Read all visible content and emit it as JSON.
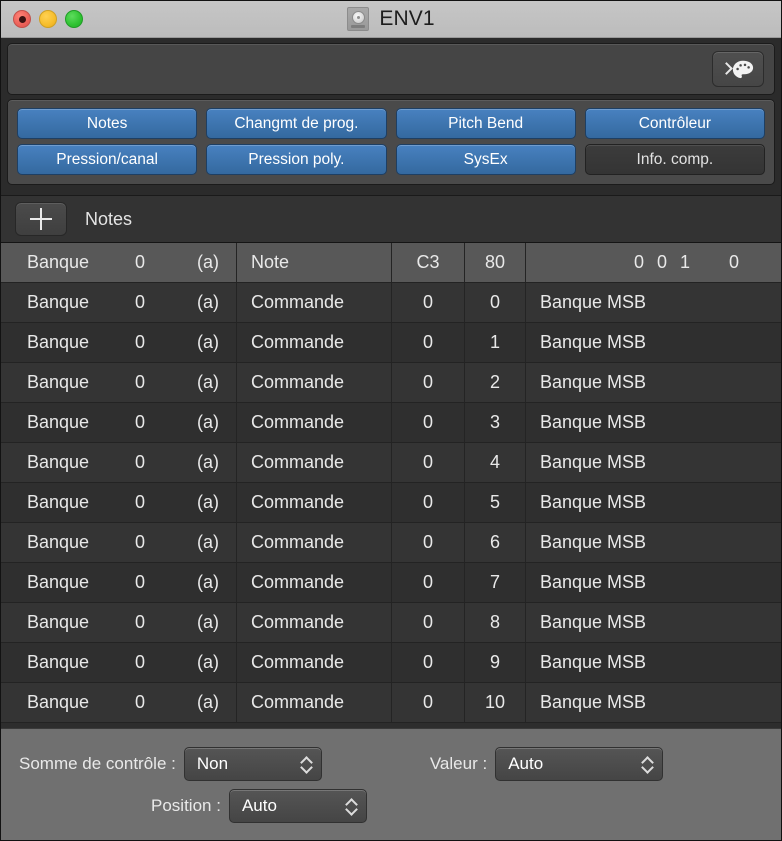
{
  "window": {
    "title": "ENV1",
    "doc_icon": "document-disc-icon",
    "traffic_lights": [
      {
        "name": "close-button",
        "color": "#ec6159"
      },
      {
        "name": "minimize-button",
        "color": "#f6bd2b"
      },
      {
        "name": "zoom-button",
        "color": "#2fc231"
      }
    ]
  },
  "toolstrip": {
    "palette_button": {
      "chevron": "›",
      "icon": "palette-icon"
    }
  },
  "event_buttons": {
    "row1": [
      {
        "label": "Notes",
        "active": true
      },
      {
        "label": "Changmt de prog.",
        "active": true
      },
      {
        "label": "Pitch Bend",
        "active": true
      },
      {
        "label": "Contrôleur",
        "active": true
      }
    ],
    "row2": [
      {
        "label": "Pression/canal",
        "active": true
      },
      {
        "label": "Pression poly.",
        "active": true
      },
      {
        "label": "SysEx",
        "active": true
      },
      {
        "label": "Info. comp.",
        "active": false
      }
    ]
  },
  "list_header": {
    "add_label": "+",
    "title": "Notes"
  },
  "table": {
    "rows": [
      {
        "bank": "Banque",
        "num": "0",
        "channel": "(a)",
        "type": "Note",
        "v1": "C3",
        "v2": "80",
        "pos_a": "0 0 1",
        "pos_b": "0",
        "selected": true
      },
      {
        "bank": "Banque",
        "num": "0",
        "channel": "(a)",
        "type": "Commande",
        "v1": "0",
        "v2": "0",
        "last": "Banque MSB",
        "selected": false
      },
      {
        "bank": "Banque",
        "num": "0",
        "channel": "(a)",
        "type": "Commande",
        "v1": "0",
        "v2": "1",
        "last": "Banque MSB",
        "selected": false
      },
      {
        "bank": "Banque",
        "num": "0",
        "channel": "(a)",
        "type": "Commande",
        "v1": "0",
        "v2": "2",
        "last": "Banque MSB",
        "selected": false
      },
      {
        "bank": "Banque",
        "num": "0",
        "channel": "(a)",
        "type": "Commande",
        "v1": "0",
        "v2": "3",
        "last": "Banque MSB",
        "selected": false
      },
      {
        "bank": "Banque",
        "num": "0",
        "channel": "(a)",
        "type": "Commande",
        "v1": "0",
        "v2": "4",
        "last": "Banque MSB",
        "selected": false
      },
      {
        "bank": "Banque",
        "num": "0",
        "channel": "(a)",
        "type": "Commande",
        "v1": "0",
        "v2": "5",
        "last": "Banque MSB",
        "selected": false
      },
      {
        "bank": "Banque",
        "num": "0",
        "channel": "(a)",
        "type": "Commande",
        "v1": "0",
        "v2": "6",
        "last": "Banque MSB",
        "selected": false
      },
      {
        "bank": "Banque",
        "num": "0",
        "channel": "(a)",
        "type": "Commande",
        "v1": "0",
        "v2": "7",
        "last": "Banque MSB",
        "selected": false
      },
      {
        "bank": "Banque",
        "num": "0",
        "channel": "(a)",
        "type": "Commande",
        "v1": "0",
        "v2": "8",
        "last": "Banque MSB",
        "selected": false
      },
      {
        "bank": "Banque",
        "num": "0",
        "channel": "(a)",
        "type": "Commande",
        "v1": "0",
        "v2": "9",
        "last": "Banque MSB",
        "selected": false
      },
      {
        "bank": "Banque",
        "num": "0",
        "channel": "(a)",
        "type": "Commande",
        "v1": "0",
        "v2": "10",
        "last": "Banque MSB",
        "selected": false
      }
    ]
  },
  "bottom": {
    "checksum_label": "Somme de contrôle :",
    "checksum_value": "Non",
    "value_label": "Valeur :",
    "value_value": "Auto",
    "position_label": "Position :",
    "position_value": "Auto"
  },
  "colors": {
    "accent_blue": "#3a76b8",
    "titlebar": "#c1c1c1",
    "panel_bg": "#2b2b2b",
    "row_selected": "#585858",
    "bottom_bg": "#707070"
  }
}
